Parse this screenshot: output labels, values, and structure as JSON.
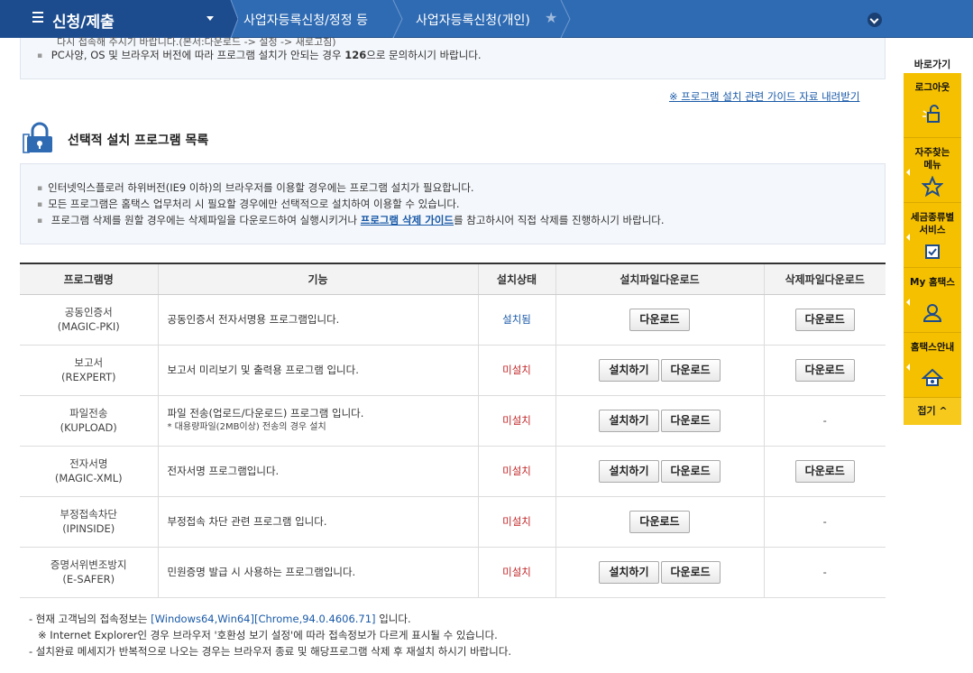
{
  "nav": {
    "menu_label": "신청/제출",
    "crumb1": "사업자등록신청/정정 등",
    "crumb2": "사업자등록신청(개인)"
  },
  "notice_top": {
    "cut_line": "다시 접속해 주시기 바랍니다.(본서:다운로드 -> 설정 -> 새로고침)",
    "line1_pre": "PC사양, OS 및 브라우저 버전에 따라 프로그램 설치가 안되는 경우 ",
    "line1_num": "126",
    "line1_post": "으로 문의하시기 바랍니다."
  },
  "guide_link": "※ 프로그램 설치 관련 가이드 자료 내려받기",
  "section": {
    "title": "선택적 설치 프로그램 목록",
    "info1": "인터넷익스플로러 하위버전(IE9 이하)의 브라우저를 이용할 경우에는 프로그램 설치가 필요합니다.",
    "info2": "모든 프로그램은 홈택스 업무처리 시 필요할 경우에만 선택적으로 설치하여 이용할 수 있습니다.",
    "info3_pre": "프로그램 삭제를 원할 경우에는 삭제파일을 다운로드하여 실행시키거나 ",
    "info3_link": "프로그램 삭제 가이드",
    "info3_post": "를 참고하시어 직접 삭제를 진행하시기 바랍니다."
  },
  "table": {
    "headers": [
      "프로그램명",
      "기능",
      "설치상태",
      "설치파일다운로드",
      "삭제파일다운로드"
    ],
    "rows": [
      {
        "name": "공동인증서",
        "code": "(MAGIC-PKI)",
        "func": "공동인증서 전자서명용 프로그램입니다.",
        "sub": "",
        "status": "설치됨"
      },
      {
        "name": "보고서",
        "code": "(REXPERT)",
        "func": "보고서 미리보기 및 출력용 프로그램 입니다.",
        "sub": "",
        "status": "미설치"
      },
      {
        "name": "파일전송",
        "code": "(KUPLOAD)",
        "func": "파일 전송(업로드/다운로드) 프로그램 입니다.",
        "sub": "* 대용량파일(2MB이상) 전송의 경우 설치",
        "status": "미설치"
      },
      {
        "name": "전자서명",
        "code": "(MAGIC-XML)",
        "func": "전자서명 프로그램입니다.",
        "sub": "",
        "status": "미설치"
      },
      {
        "name": "부정접속차단",
        "code": "(IPINSIDE)",
        "func": "부정접속 차단 관련 프로그램 입니다.",
        "sub": "",
        "status": "미설치"
      },
      {
        "name": "증명서위변조방지",
        "code": "(E-SAFER)",
        "func": "민원증명 발급 시 사용하는 프로그램입니다.",
        "sub": "",
        "status": "미설치"
      }
    ],
    "install_label": "설치하기",
    "download_label": "다운로드",
    "dash": "-"
  },
  "footer": {
    "line1_pre": "- 현재 고객님의 접속정보는 ",
    "line1_info": "[Windows64,Win64][Chrome,94.0.4606.71]",
    "line1_post": " 입니다.",
    "line2": "※ Internet Explorer인 경우 브라우저 '호환성 보기 설정'에 따라 접속정보가 다르게 표시될 수 있습니다.",
    "line3": "- 설치완료 메세지가 반복적으로 나오는 경우는 브라우저 종료 및 해당프로그램 삭제 후 재설치 하시기 바랍니다."
  },
  "quick": {
    "title": "바로가기",
    "items": [
      {
        "label": "로그아웃",
        "icon": "unlock-icon"
      },
      {
        "label": "자주찾는\n메뉴",
        "icon": "star-icon"
      },
      {
        "label": "세금종류별\n서비스",
        "icon": "check-icon"
      },
      {
        "label": "My 홈택스",
        "icon": "user-icon"
      },
      {
        "label": "홈택스안내",
        "icon": "home-icon"
      }
    ],
    "fold": "접기 ^"
  },
  "colors": {
    "nav_bg": "#2f6bb3",
    "nav_first_bg": "#1d4c8e",
    "quick_bg": "#f5c000",
    "link": "#1a5aa8",
    "not_installed": "#c0282a"
  }
}
